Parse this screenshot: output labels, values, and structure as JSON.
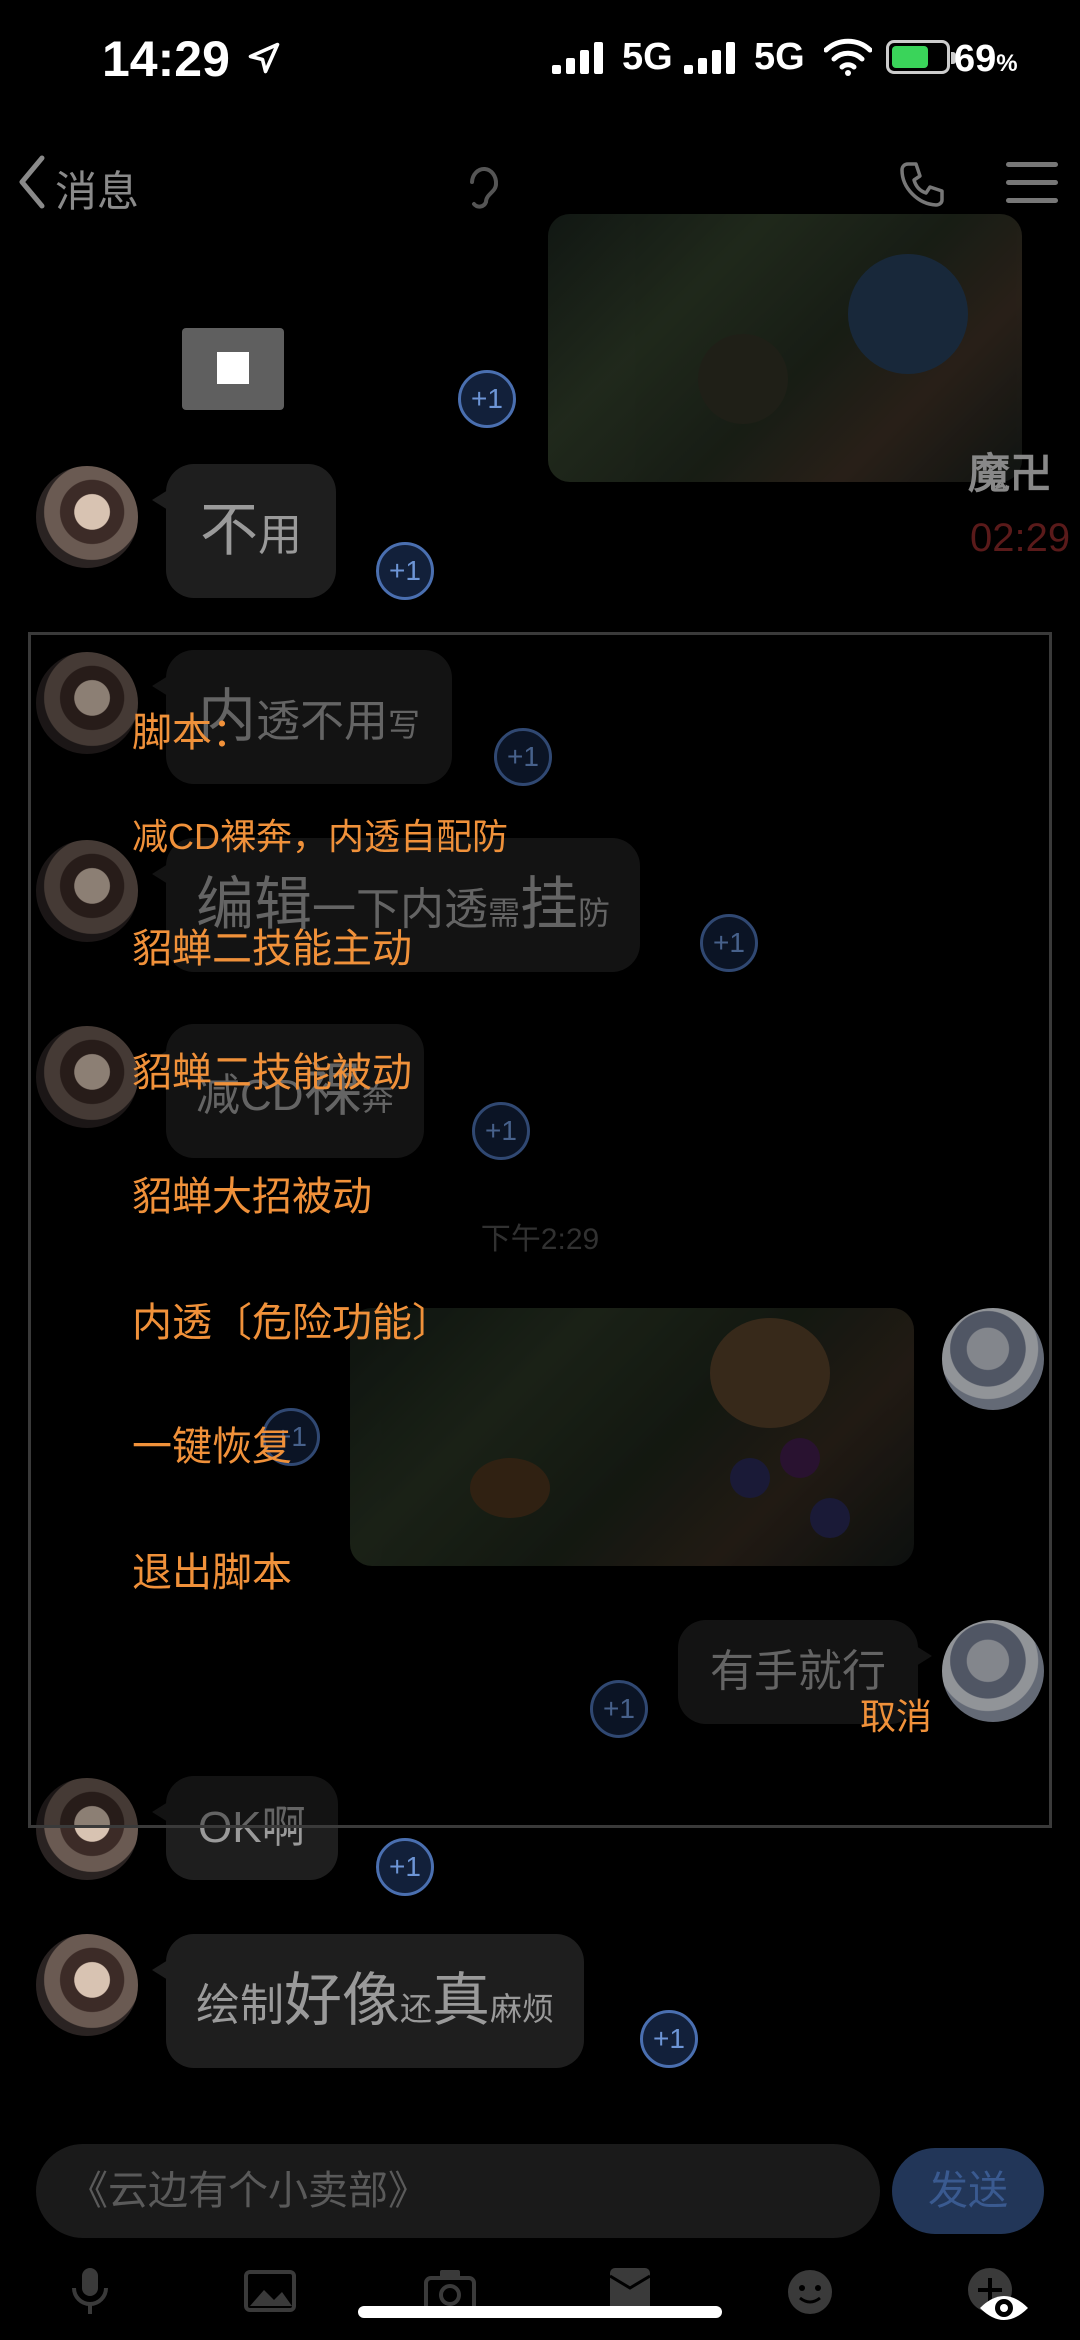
{
  "status_bar": {
    "time": "14:29",
    "network_1": "5G",
    "network_2": "5G",
    "battery": "69",
    "battery_unit": "%",
    "battery_level": 0.69
  },
  "nav": {
    "back_label": "消息"
  },
  "chat": {
    "timestamp": "下午2:29",
    "plus_one": "+1",
    "messages": [
      {
        "parts": [
          {
            "t": "不",
            "s": "big"
          },
          {
            "t": "用",
            "s": "mid"
          }
        ]
      },
      {
        "parts": [
          {
            "t": "内",
            "s": "big"
          },
          {
            "t": "透不用",
            "s": "mid"
          },
          {
            "t": "写",
            "s": "sm"
          }
        ]
      },
      {
        "parts": [
          {
            "t": "编辑",
            "s": "big"
          },
          {
            "t": "一下内透",
            "s": "mid"
          },
          {
            "t": "需",
            "s": "sm"
          },
          {
            "t": "挂",
            "s": "big"
          },
          {
            "t": "防",
            "s": "sm"
          }
        ]
      },
      {
        "parts": [
          {
            "t": "减CD",
            "s": "mid"
          },
          {
            "t": "裸",
            "s": "big"
          },
          {
            "t": "奔",
            "s": "sm"
          }
        ]
      },
      {
        "parts": [
          {
            "t": "有手就行",
            "s": "mid"
          }
        ]
      },
      {
        "parts": [
          {
            "t": "OK",
            "s": "mid"
          },
          {
            "t": "啊",
            "s": "mid"
          }
        ]
      },
      {
        "parts": [
          {
            "t": "绘制",
            "s": "mid"
          },
          {
            "t": "好像",
            "s": "big"
          },
          {
            "t": "还",
            "s": "sm"
          },
          {
            "t": "真",
            "s": "big"
          },
          {
            "t": "麻烦",
            "s": "sm"
          }
        ]
      }
    ]
  },
  "overlay": {
    "side_name": "魔卍",
    "side_timer": "02:29",
    "items": [
      "脚本：",
      "减CD裸奔，内透自配防",
      "貂蝉二技能主动",
      "貂蝉二技能被动",
      "貂蝉大招被动",
      "内透〔危险功能〕",
      "一键恢复",
      "退出脚本"
    ],
    "cancel": "取消"
  },
  "input": {
    "text": "《云边有个小卖部》",
    "send": "发送"
  },
  "toolbar": {
    "icons": [
      "mic-icon",
      "image-icon",
      "camera-icon",
      "red-packet-icon",
      "emoji-icon",
      "plus-icon"
    ]
  },
  "colors": {
    "accent_orange": "#f0913a",
    "bubble_bg": "#1e1e1e",
    "plus_badge": "#4a6fb0"
  }
}
